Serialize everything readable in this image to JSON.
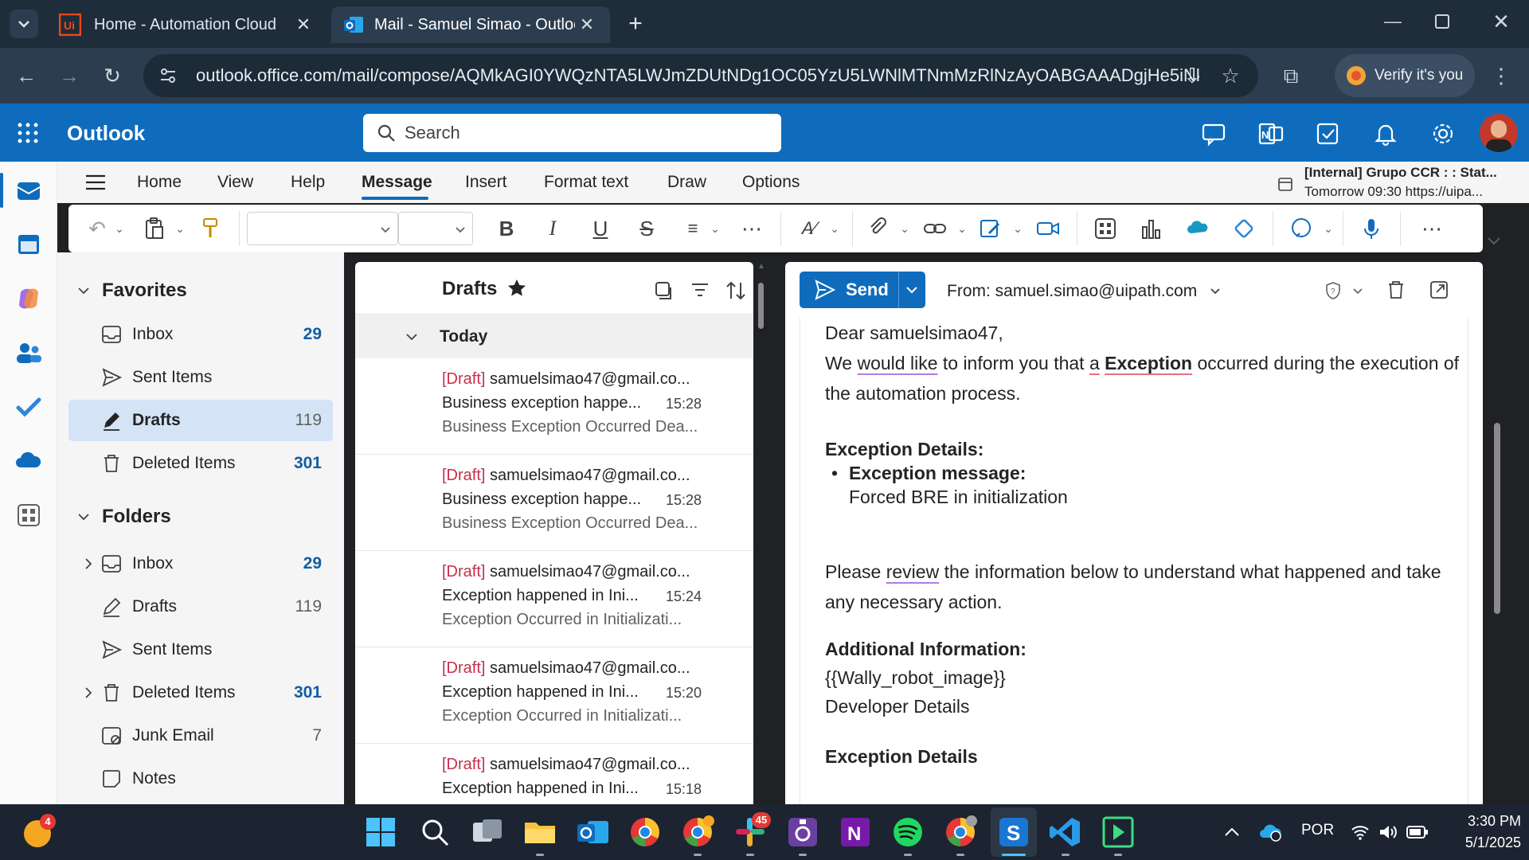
{
  "browser": {
    "tabs": [
      {
        "title": "Home - Automation Cloud",
        "favicon": "uipath-icon"
      },
      {
        "title": "Mail - Samuel Simao - Outlook",
        "favicon": "outlook-icon"
      }
    ],
    "url": "outlook.office.com/mail/compose/AQMkAGI0YWQzNTA5LWJmZDUtNDg1OC05YzU5LWNlMTNmMzRlNzAyOABGAAADgjHe5iNkJk...",
    "verify_label": "Verify it's you"
  },
  "outlook": {
    "brand": "Outlook",
    "search_placeholder": "Search",
    "accent": "#0f6cbd"
  },
  "ribbon": {
    "tabs": [
      "Home",
      "View",
      "Help",
      "Message",
      "Insert",
      "Format text",
      "Draw",
      "Options"
    ],
    "selected_tab": "Message",
    "reminder_title": "[Internal] Grupo CCR : : Stat...",
    "reminder_time": "Tomorrow 09:30 https://uipa..."
  },
  "folders": {
    "favorites_label": "Favorites",
    "favorites": [
      {
        "name": "Inbox",
        "count": "29",
        "icon": "inbox-icon"
      },
      {
        "name": "Sent Items",
        "count": "",
        "icon": "send-icon"
      },
      {
        "name": "Drafts",
        "count": "119",
        "icon": "pencil-icon"
      },
      {
        "name": "Deleted Items",
        "count": "301",
        "icon": "trash-icon"
      }
    ],
    "folders_label": "Folders",
    "folders": [
      {
        "name": "Inbox",
        "count": "29",
        "icon": "inbox-icon"
      },
      {
        "name": "Drafts",
        "count": "119",
        "icon": "pencil-icon"
      },
      {
        "name": "Sent Items",
        "count": "",
        "icon": "send-icon"
      },
      {
        "name": "Deleted Items",
        "count": "301",
        "icon": "trash-icon"
      },
      {
        "name": "Junk Email",
        "count": "7",
        "icon": "junk-icon"
      },
      {
        "name": "Notes",
        "count": "",
        "icon": "note-icon"
      }
    ]
  },
  "message_list": {
    "title": "Drafts",
    "group": "Today",
    "messages": [
      {
        "draft": "[Draft]",
        "from": "samuelsimao47@gmail.co...",
        "subject": "Business exception happe...",
        "time": "15:28",
        "preview": "Business Exception Occurred Dea..."
      },
      {
        "draft": "[Draft]",
        "from": "samuelsimao47@gmail.co...",
        "subject": "Business exception happe...",
        "time": "15:28",
        "preview": "Business Exception Occurred Dea..."
      },
      {
        "draft": "[Draft]",
        "from": "samuelsimao47@gmail.co...",
        "subject": "Exception happened in Ini...",
        "time": "15:24",
        "preview": "Exception Occurred in Initializati..."
      },
      {
        "draft": "[Draft]",
        "from": "samuelsimao47@gmail.co...",
        "subject": "Exception happened in Ini...",
        "time": "15:20",
        "preview": "Exception Occurred in Initializati..."
      },
      {
        "draft": "[Draft]",
        "from": "samuelsimao47@gmail.co...",
        "subject": "Exception happened in Ini...",
        "time": "15:18",
        "preview": ""
      }
    ]
  },
  "compose": {
    "send_label": "Send",
    "from": "From: samuel.simao@uipath.com",
    "body": {
      "greeting": "Dear samuelsimao47,",
      "intro_1": "We ",
      "intro_would_like": "would like",
      "intro_2": " to inform you that ",
      "intro_a": "a",
      "intro_space": " ",
      "intro_exception": "Exception",
      "intro_3": " occurred during the execution of the automation process.",
      "details_heading": "Exception Details:",
      "bullet_label": "Exception message:",
      "bullet_value": "Forced BRE in initialization",
      "review_1": "Please ",
      "review_word": "review",
      "review_2": " the information below to understand what happened and take any necessary action.",
      "additional_heading": "Additional Information:",
      "robot_image": "{{Wally_robot_image}}",
      "developer_details": "Developer Details",
      "details_heading_2": "Exception Details"
    }
  },
  "taskbar": {
    "notification_count": "4",
    "slack_badge": "45",
    "lang": "POR",
    "time": "3:30 PM",
    "date": "5/1/2025"
  }
}
